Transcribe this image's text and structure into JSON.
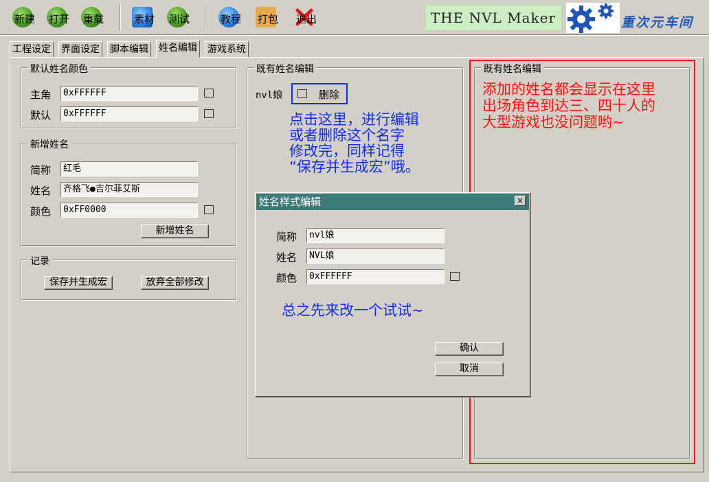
{
  "toolbar": {
    "buttons": [
      {
        "label": "新建",
        "icon": "new-file-icon"
      },
      {
        "label": "打开",
        "icon": "open-folder-icon"
      },
      {
        "label": "重载",
        "icon": "reload-icon"
      },
      {
        "label": "素材",
        "icon": "assets-icon"
      },
      {
        "label": "测试",
        "icon": "test-run-icon"
      },
      {
        "label": "教程",
        "icon": "tutorial-info-icon"
      },
      {
        "label": "打包",
        "icon": "package-box-icon"
      },
      {
        "label": "退出",
        "icon": "exit-x-icon"
      }
    ],
    "banner_text": "THE NVL Maker",
    "brand_logo_icon": "gear-logo-icon",
    "brand_text": "重次元车间"
  },
  "tabs": [
    {
      "label": "工程设定",
      "active": false
    },
    {
      "label": "界面设定",
      "active": false
    },
    {
      "label": "脚本编辑",
      "active": false
    },
    {
      "label": "姓名编辑",
      "active": true
    },
    {
      "label": "游戏系统",
      "active": false
    }
  ],
  "default_colors": {
    "title": "默认姓名颜色",
    "rows": [
      {
        "label": "主角",
        "value": "0xFFFFFF"
      },
      {
        "label": "默认",
        "value": "0xFFFFFF"
      }
    ]
  },
  "add_name": {
    "title": "新增姓名",
    "short_label": "简称",
    "short_value": "红毛",
    "name_label": "姓名",
    "name_value": "齐格飞●吉尔菲艾斯",
    "color_label": "颜色",
    "color_value": "0xFF0000",
    "add_button": "新增姓名"
  },
  "record": {
    "title": "记录",
    "save_button": "保存并生成宏",
    "discard_button": "放弃全部修改"
  },
  "existing_names": {
    "title": "既有姓名编辑",
    "entries": [
      {
        "name": "nvl娘",
        "delete_label": "删除"
      }
    ]
  },
  "existing_names_right": {
    "title": "既有姓名编辑"
  },
  "annotations": {
    "blue_lines": [
      "点击这里，进行编辑",
      "或者删除这个名字",
      "修改完，同样记得",
      "“保存并生成宏”哦。"
    ],
    "red_lines": [
      "添加的姓名都会显示在这里",
      "出场角色到达三、四十人的",
      "大型游戏也没问题哟~"
    ],
    "dialog_hint": "总之先来改一个试试~",
    "blue_color": "#1030e8",
    "red_color": "#ff1010"
  },
  "dialog": {
    "title": "姓名样式编辑",
    "close_label": "×",
    "short_label": "简称",
    "short_value": "nvl娘",
    "name_label": "姓名",
    "name_value": "NVL娘",
    "color_label": "颜色",
    "color_value": "0xFFFFFF",
    "ok_button": "确认",
    "cancel_button": "取消"
  }
}
